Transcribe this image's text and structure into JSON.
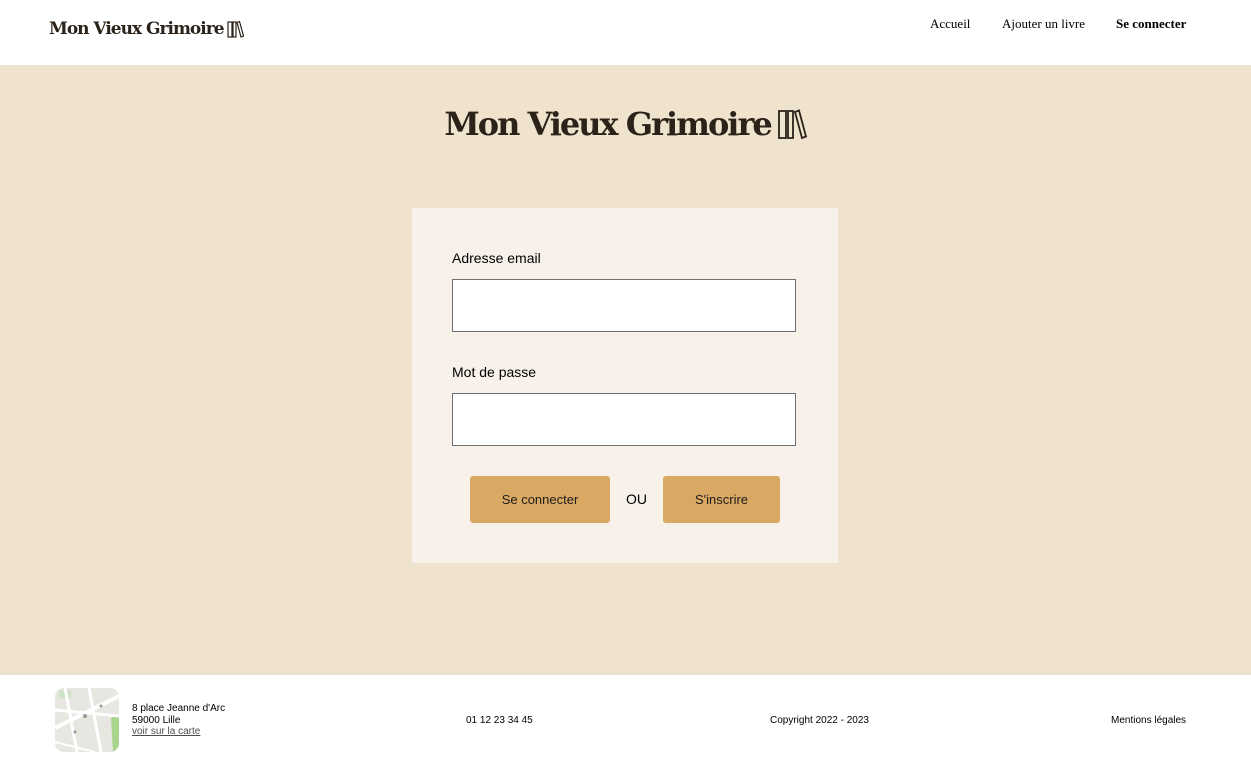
{
  "header": {
    "brand": "Mon Vieux Grimoire",
    "brand_icon": "books-icon",
    "nav": [
      "Accueil",
      "Ajouter un livre",
      "Se connecter"
    ],
    "active_nav": "Se connecter"
  },
  "hero": {
    "title": "Mon Vieux Grimoire",
    "icon": "books-icon"
  },
  "form": {
    "email_label": "Adresse email",
    "email_value": "",
    "password_label": "Mot de passe",
    "password_value": "",
    "login_button": "Se connecter",
    "or_text": "OU",
    "signup_button": "S'inscrire"
  },
  "footer": {
    "map_icon": "map-thumbnail",
    "address_line1": "8 place Jeanne d'Arc",
    "address_line2": "59000 Lille",
    "map_link": "voir sur la carte",
    "phone": "01 12 23 34 45",
    "copyright": "Copyright 2022 - 2023",
    "legal": "Mentions légales"
  },
  "colors": {
    "background": "#f0e3cd",
    "card": "#f7f1ea",
    "button": "#d9a862",
    "brand_text": "#2b2219"
  }
}
